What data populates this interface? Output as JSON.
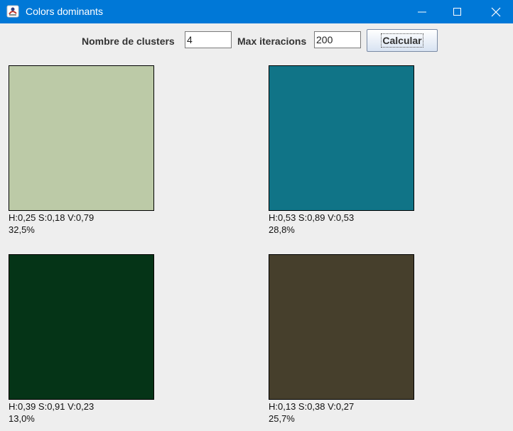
{
  "window": {
    "title": "Colors dominants"
  },
  "toolbar": {
    "clusters_label": "Nombre de clusters",
    "clusters_value": "4",
    "max_iter_label": "Max iteracions",
    "max_iter_value": "200",
    "calculate_label": "Calcular"
  },
  "clusters": [
    {
      "hsv": "H:0,25 S:0,18 V:0,79",
      "percent": "32,5%",
      "color": "#bccaa7"
    },
    {
      "hsv": "H:0,53 S:0,89 V:0,53",
      "percent": "28,8%",
      "color": "#107487"
    },
    {
      "hsv": "H:0,39 S:0,91 V:0,23",
      "percent": "13,0%",
      "color": "#053417"
    },
    {
      "hsv": "H:0,13 S:0,38 V:0,27",
      "percent": "25,7%",
      "color": "#463f2c"
    }
  ]
}
